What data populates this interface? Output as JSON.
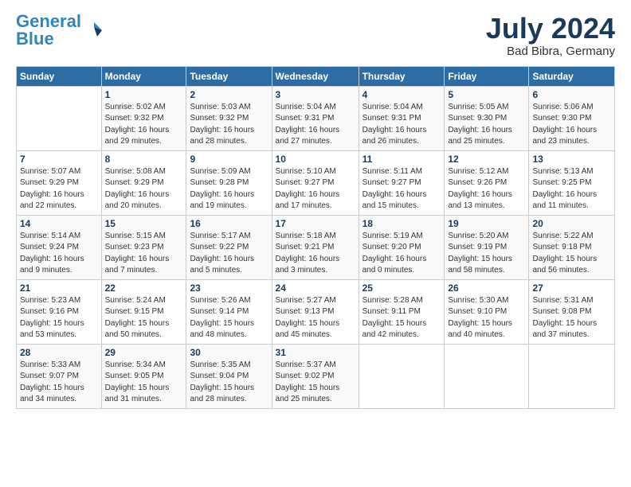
{
  "logo": {
    "line1": "General",
    "line2": "Blue"
  },
  "title": "July 2024",
  "location": "Bad Bibra, Germany",
  "headers": [
    "Sunday",
    "Monday",
    "Tuesday",
    "Wednesday",
    "Thursday",
    "Friday",
    "Saturday"
  ],
  "weeks": [
    [
      {
        "num": "",
        "sunrise": "",
        "sunset": "",
        "daylight": ""
      },
      {
        "num": "1",
        "sunrise": "Sunrise: 5:02 AM",
        "sunset": "Sunset: 9:32 PM",
        "daylight": "Daylight: 16 hours and 29 minutes."
      },
      {
        "num": "2",
        "sunrise": "Sunrise: 5:03 AM",
        "sunset": "Sunset: 9:32 PM",
        "daylight": "Daylight: 16 hours and 28 minutes."
      },
      {
        "num": "3",
        "sunrise": "Sunrise: 5:04 AM",
        "sunset": "Sunset: 9:31 PM",
        "daylight": "Daylight: 16 hours and 27 minutes."
      },
      {
        "num": "4",
        "sunrise": "Sunrise: 5:04 AM",
        "sunset": "Sunset: 9:31 PM",
        "daylight": "Daylight: 16 hours and 26 minutes."
      },
      {
        "num": "5",
        "sunrise": "Sunrise: 5:05 AM",
        "sunset": "Sunset: 9:30 PM",
        "daylight": "Daylight: 16 hours and 25 minutes."
      },
      {
        "num": "6",
        "sunrise": "Sunrise: 5:06 AM",
        "sunset": "Sunset: 9:30 PM",
        "daylight": "Daylight: 16 hours and 23 minutes."
      }
    ],
    [
      {
        "num": "7",
        "sunrise": "Sunrise: 5:07 AM",
        "sunset": "Sunset: 9:29 PM",
        "daylight": "Daylight: 16 hours and 22 minutes."
      },
      {
        "num": "8",
        "sunrise": "Sunrise: 5:08 AM",
        "sunset": "Sunset: 9:29 PM",
        "daylight": "Daylight: 16 hours and 20 minutes."
      },
      {
        "num": "9",
        "sunrise": "Sunrise: 5:09 AM",
        "sunset": "Sunset: 9:28 PM",
        "daylight": "Daylight: 16 hours and 19 minutes."
      },
      {
        "num": "10",
        "sunrise": "Sunrise: 5:10 AM",
        "sunset": "Sunset: 9:27 PM",
        "daylight": "Daylight: 16 hours and 17 minutes."
      },
      {
        "num": "11",
        "sunrise": "Sunrise: 5:11 AM",
        "sunset": "Sunset: 9:27 PM",
        "daylight": "Daylight: 16 hours and 15 minutes."
      },
      {
        "num": "12",
        "sunrise": "Sunrise: 5:12 AM",
        "sunset": "Sunset: 9:26 PM",
        "daylight": "Daylight: 16 hours and 13 minutes."
      },
      {
        "num": "13",
        "sunrise": "Sunrise: 5:13 AM",
        "sunset": "Sunset: 9:25 PM",
        "daylight": "Daylight: 16 hours and 11 minutes."
      }
    ],
    [
      {
        "num": "14",
        "sunrise": "Sunrise: 5:14 AM",
        "sunset": "Sunset: 9:24 PM",
        "daylight": "Daylight: 16 hours and 9 minutes."
      },
      {
        "num": "15",
        "sunrise": "Sunrise: 5:15 AM",
        "sunset": "Sunset: 9:23 PM",
        "daylight": "Daylight: 16 hours and 7 minutes."
      },
      {
        "num": "16",
        "sunrise": "Sunrise: 5:17 AM",
        "sunset": "Sunset: 9:22 PM",
        "daylight": "Daylight: 16 hours and 5 minutes."
      },
      {
        "num": "17",
        "sunrise": "Sunrise: 5:18 AM",
        "sunset": "Sunset: 9:21 PM",
        "daylight": "Daylight: 16 hours and 3 minutes."
      },
      {
        "num": "18",
        "sunrise": "Sunrise: 5:19 AM",
        "sunset": "Sunset: 9:20 PM",
        "daylight": "Daylight: 16 hours and 0 minutes."
      },
      {
        "num": "19",
        "sunrise": "Sunrise: 5:20 AM",
        "sunset": "Sunset: 9:19 PM",
        "daylight": "Daylight: 15 hours and 58 minutes."
      },
      {
        "num": "20",
        "sunrise": "Sunrise: 5:22 AM",
        "sunset": "Sunset: 9:18 PM",
        "daylight": "Daylight: 15 hours and 56 minutes."
      }
    ],
    [
      {
        "num": "21",
        "sunrise": "Sunrise: 5:23 AM",
        "sunset": "Sunset: 9:16 PM",
        "daylight": "Daylight: 15 hours and 53 minutes."
      },
      {
        "num": "22",
        "sunrise": "Sunrise: 5:24 AM",
        "sunset": "Sunset: 9:15 PM",
        "daylight": "Daylight: 15 hours and 50 minutes."
      },
      {
        "num": "23",
        "sunrise": "Sunrise: 5:26 AM",
        "sunset": "Sunset: 9:14 PM",
        "daylight": "Daylight: 15 hours and 48 minutes."
      },
      {
        "num": "24",
        "sunrise": "Sunrise: 5:27 AM",
        "sunset": "Sunset: 9:13 PM",
        "daylight": "Daylight: 15 hours and 45 minutes."
      },
      {
        "num": "25",
        "sunrise": "Sunrise: 5:28 AM",
        "sunset": "Sunset: 9:11 PM",
        "daylight": "Daylight: 15 hours and 42 minutes."
      },
      {
        "num": "26",
        "sunrise": "Sunrise: 5:30 AM",
        "sunset": "Sunset: 9:10 PM",
        "daylight": "Daylight: 15 hours and 40 minutes."
      },
      {
        "num": "27",
        "sunrise": "Sunrise: 5:31 AM",
        "sunset": "Sunset: 9:08 PM",
        "daylight": "Daylight: 15 hours and 37 minutes."
      }
    ],
    [
      {
        "num": "28",
        "sunrise": "Sunrise: 5:33 AM",
        "sunset": "Sunset: 9:07 PM",
        "daylight": "Daylight: 15 hours and 34 minutes."
      },
      {
        "num": "29",
        "sunrise": "Sunrise: 5:34 AM",
        "sunset": "Sunset: 9:05 PM",
        "daylight": "Daylight: 15 hours and 31 minutes."
      },
      {
        "num": "30",
        "sunrise": "Sunrise: 5:35 AM",
        "sunset": "Sunset: 9:04 PM",
        "daylight": "Daylight: 15 hours and 28 minutes."
      },
      {
        "num": "31",
        "sunrise": "Sunrise: 5:37 AM",
        "sunset": "Sunset: 9:02 PM",
        "daylight": "Daylight: 15 hours and 25 minutes."
      },
      {
        "num": "",
        "sunrise": "",
        "sunset": "",
        "daylight": ""
      },
      {
        "num": "",
        "sunrise": "",
        "sunset": "",
        "daylight": ""
      },
      {
        "num": "",
        "sunrise": "",
        "sunset": "",
        "daylight": ""
      }
    ]
  ]
}
